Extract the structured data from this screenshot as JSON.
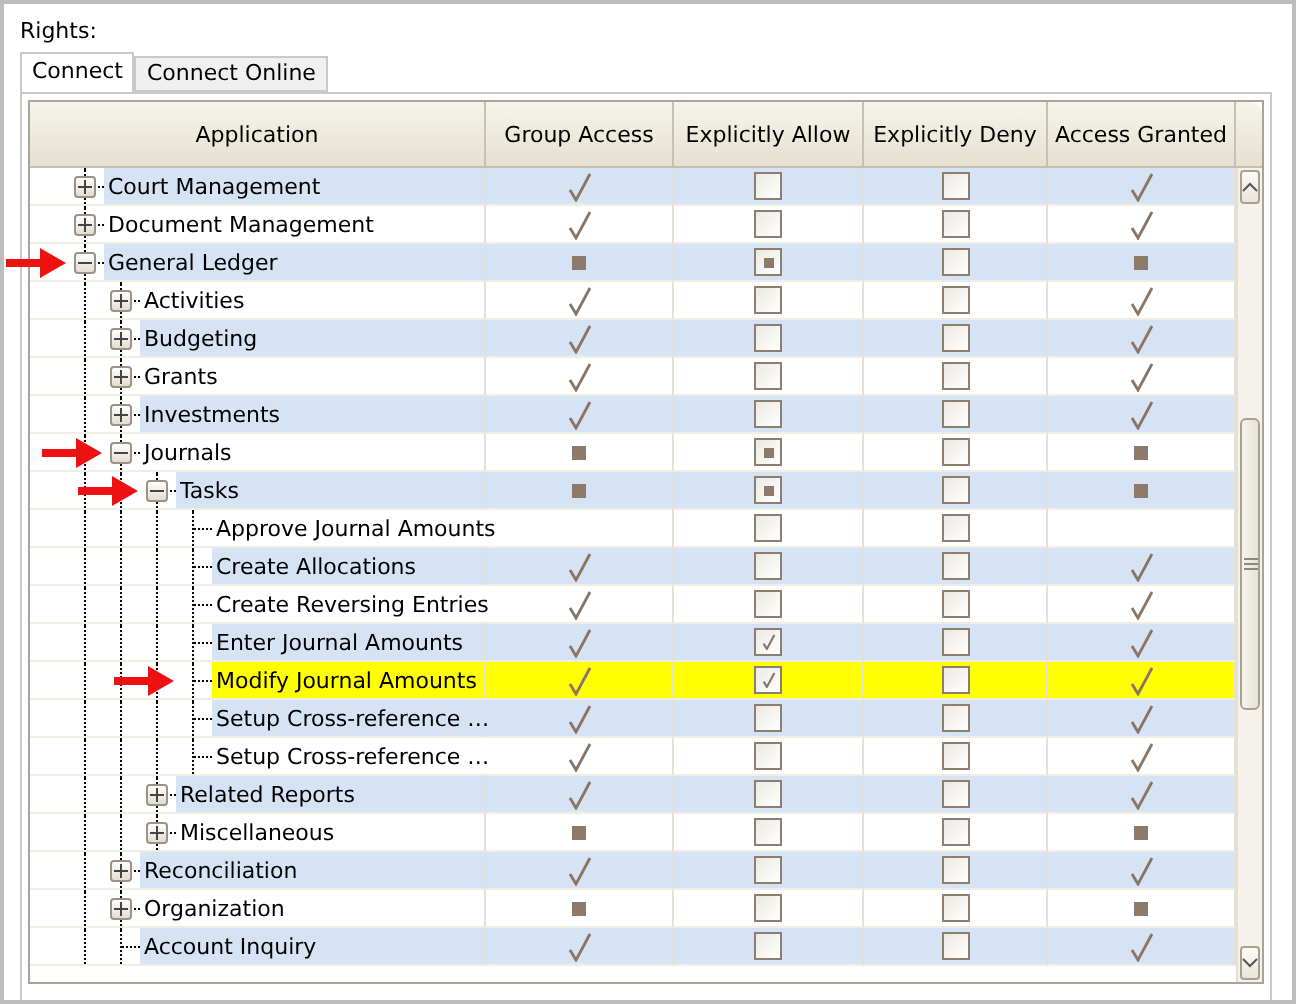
{
  "label": "Rights:",
  "tabs": [
    {
      "label": "Connect",
      "selected": true
    },
    {
      "label": "Connect Online",
      "selected": false
    }
  ],
  "columns": [
    "Application",
    "Group Access",
    "Explicitly Allow",
    "Explicitly Deny",
    "Access Granted"
  ],
  "applications": [
    {
      "name": "Court Management",
      "expanded": false,
      "group_access": {
        "kind": "check"
      },
      "allow": {
        "checked": false
      },
      "deny": {
        "checked": false
      },
      "granted": {
        "kind": "check"
      }
    },
    {
      "name": "Document Management",
      "expanded": false,
      "group_access": {
        "kind": "check"
      },
      "allow": {
        "checked": false
      },
      "deny": {
        "checked": false
      },
      "granted": {
        "kind": "check"
      }
    },
    {
      "name": "General Ledger",
      "expanded": true,
      "arrow": true,
      "group_access": {
        "kind": "square"
      },
      "allow": {
        "indeterminate": true
      },
      "deny": {
        "checked": false
      },
      "granted": {
        "kind": "square"
      },
      "children": [
        {
          "name": "Activities",
          "expanded": false,
          "group_access": {
            "kind": "check"
          },
          "allow": {
            "checked": false
          },
          "deny": {
            "checked": false
          },
          "granted": {
            "kind": "check"
          }
        },
        {
          "name": "Budgeting",
          "expanded": false,
          "group_access": {
            "kind": "check"
          },
          "allow": {
            "checked": false
          },
          "deny": {
            "checked": false
          },
          "granted": {
            "kind": "check"
          }
        },
        {
          "name": "Grants",
          "expanded": false,
          "group_access": {
            "kind": "check"
          },
          "allow": {
            "checked": false
          },
          "deny": {
            "checked": false
          },
          "granted": {
            "kind": "check"
          }
        },
        {
          "name": "Investments",
          "expanded": false,
          "group_access": {
            "kind": "check"
          },
          "allow": {
            "checked": false
          },
          "deny": {
            "checked": false
          },
          "granted": {
            "kind": "check"
          }
        },
        {
          "name": "Journals",
          "expanded": true,
          "arrow": true,
          "group_access": {
            "kind": "square"
          },
          "allow": {
            "indeterminate": true
          },
          "deny": {
            "checked": false
          },
          "granted": {
            "kind": "square"
          },
          "children": [
            {
              "name": "Tasks",
              "expanded": true,
              "arrow": true,
              "group_access": {
                "kind": "square"
              },
              "allow": {
                "indeterminate": true
              },
              "deny": {
                "checked": false
              },
              "granted": {
                "kind": "square"
              },
              "children": [
                {
                  "name": "Approve Journal Amounts",
                  "allow": {
                    "checked": false
                  },
                  "deny": {
                    "checked": false
                  }
                },
                {
                  "name": "Create Allocations",
                  "group_access": {
                    "kind": "check"
                  },
                  "allow": {
                    "checked": false
                  },
                  "deny": {
                    "checked": false
                  },
                  "granted": {
                    "kind": "check"
                  }
                },
                {
                  "name": "Create Reversing Entries",
                  "group_access": {
                    "kind": "check"
                  },
                  "allow": {
                    "checked": false
                  },
                  "deny": {
                    "checked": false
                  },
                  "granted": {
                    "kind": "check"
                  }
                },
                {
                  "name": "Enter Journal Amounts",
                  "group_access": {
                    "kind": "check"
                  },
                  "allow": {
                    "checked": true
                  },
                  "deny": {
                    "checked": false
                  },
                  "granted": {
                    "kind": "check"
                  }
                },
                {
                  "name": "Modify Journal Amounts",
                  "arrow": true,
                  "highlighted": true,
                  "group_access": {
                    "kind": "check"
                  },
                  "allow": {
                    "checked": true
                  },
                  "deny": {
                    "checked": false
                  },
                  "granted": {
                    "kind": "check"
                  }
                },
                {
                  "name": "Setup Cross-reference …",
                  "group_access": {
                    "kind": "check"
                  },
                  "allow": {
                    "checked": false
                  },
                  "deny": {
                    "checked": false
                  },
                  "granted": {
                    "kind": "check"
                  }
                },
                {
                  "name": "Setup Cross-reference …",
                  "group_access": {
                    "kind": "check"
                  },
                  "allow": {
                    "checked": false
                  },
                  "deny": {
                    "checked": false
                  },
                  "granted": {
                    "kind": "check"
                  }
                }
              ]
            },
            {
              "name": "Related Reports",
              "expanded": false,
              "group_access": {
                "kind": "check"
              },
              "allow": {
                "checked": false
              },
              "deny": {
                "checked": false
              },
              "granted": {
                "kind": "check"
              }
            },
            {
              "name": "Miscellaneous",
              "expanded": false,
              "group_access": {
                "kind": "square"
              },
              "allow": {
                "checked": false
              },
              "deny": {
                "checked": false
              },
              "granted": {
                "kind": "square"
              }
            }
          ]
        },
        {
          "name": "Reconciliation",
          "expanded": false,
          "group_access": {
            "kind": "check"
          },
          "allow": {
            "checked": false
          },
          "deny": {
            "checked": false
          },
          "granted": {
            "kind": "check"
          }
        },
        {
          "name": "Organization",
          "expanded": false,
          "group_access": {
            "kind": "square"
          },
          "allow": {
            "checked": false
          },
          "deny": {
            "checked": false
          },
          "granted": {
            "kind": "square"
          }
        },
        {
          "name": "Account Inquiry",
          "group_access": {
            "kind": "check"
          },
          "allow": {
            "checked": false
          },
          "deny": {
            "checked": false
          },
          "granted": {
            "kind": "check"
          }
        }
      ]
    }
  ]
}
